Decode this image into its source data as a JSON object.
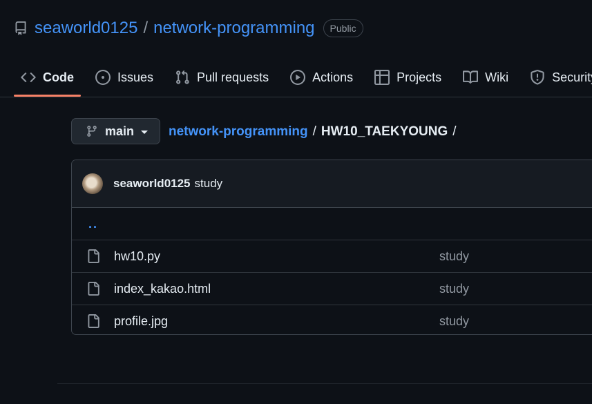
{
  "repo": {
    "owner": "seaworld0125",
    "separator": "/",
    "name": "network-programming",
    "visibility": "Public"
  },
  "tabs": [
    {
      "label": "Code",
      "icon": "code-icon",
      "active": true
    },
    {
      "label": "Issues",
      "icon": "issue-icon"
    },
    {
      "label": "Pull requests",
      "icon": "pull-request-icon"
    },
    {
      "label": "Actions",
      "icon": "play-icon"
    },
    {
      "label": "Projects",
      "icon": "table-icon"
    },
    {
      "label": "Wiki",
      "icon": "book-icon"
    },
    {
      "label": "Security",
      "icon": "shield-icon"
    }
  ],
  "branch": {
    "name": "main",
    "icon": "git-branch-icon"
  },
  "breadcrumb": {
    "repo": "network-programming",
    "separator": "/",
    "folder": "HW10_TAEKYOUNG",
    "trailing": "/"
  },
  "commit": {
    "author": "seaworld0125",
    "message": "study"
  },
  "files": {
    "parent_link": "..",
    "items": [
      {
        "name": "hw10.py",
        "commit": "study",
        "icon": "file-icon"
      },
      {
        "name": "index_kakao.html",
        "commit": "study",
        "icon": "file-icon"
      },
      {
        "name": "profile.jpg",
        "commit": "study",
        "icon": "file-icon"
      }
    ]
  },
  "colors": {
    "background": "#0d1117",
    "link": "#4493f8",
    "active_underline": "#f78166",
    "muted": "#9198a1",
    "border": "#3d444d"
  }
}
